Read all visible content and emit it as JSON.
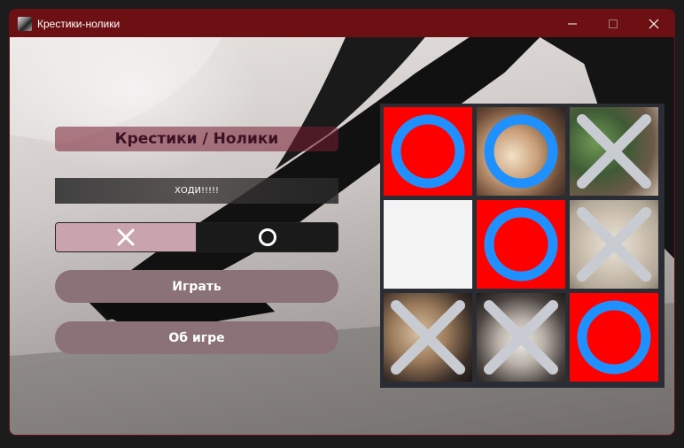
{
  "window": {
    "title": "Крестики-нолики",
    "controls": [
      "minimize-icon",
      "maximize-icon",
      "close-icon"
    ],
    "titlebar_color": "#6d1014"
  },
  "game": {
    "heading": "Крестики / Нолики",
    "status": "ХОДИ!!!!!",
    "player_choice": {
      "options": [
        "x",
        "o"
      ],
      "selected": "x"
    },
    "buttons": {
      "play": "Играть",
      "about": "Об игре"
    },
    "board": [
      [
        "O",
        "O",
        "X"
      ],
      [
        "",
        "O",
        "X"
      ],
      [
        "X",
        "X",
        "O"
      ]
    ],
    "colors": {
      "o_mark": "#1e90ff",
      "x_mark": "#c8ccd2",
      "cell_red": "#ff0000",
      "board_bg": "#2b2d35"
    }
  }
}
